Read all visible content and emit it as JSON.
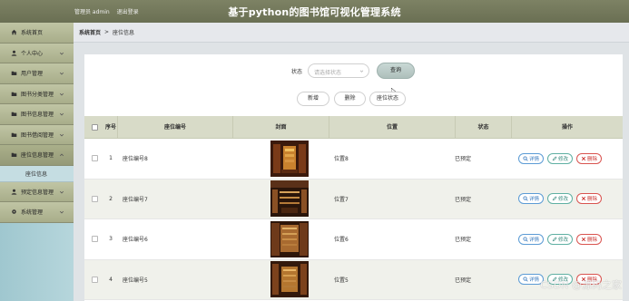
{
  "header": {
    "user_label": "管理员 admin",
    "logout_label": "退出登录",
    "title": "基于python的图书馆可视化管理系统"
  },
  "sidebar": {
    "items": [
      {
        "label": "系统首页",
        "icon": "home-icon",
        "has_chevron": false
      },
      {
        "label": "个人中心",
        "icon": "user-icon",
        "has_chevron": true
      },
      {
        "label": "用户管理",
        "icon": "folder-icon",
        "has_chevron": true
      },
      {
        "label": "图书分类管理",
        "icon": "folder-icon",
        "has_chevron": true
      },
      {
        "label": "图书信息管理",
        "icon": "folder-icon",
        "has_chevron": true
      },
      {
        "label": "图书借阅管理",
        "icon": "folder-icon",
        "has_chevron": true
      },
      {
        "label": "座位信息管理",
        "icon": "folder-icon",
        "has_chevron": true,
        "active": true
      },
      {
        "label": "预定信息管理",
        "icon": "user-icon",
        "has_chevron": true
      },
      {
        "label": "系统管理",
        "icon": "gear-icon",
        "has_chevron": true
      }
    ],
    "submenu_label": "座位信息"
  },
  "breadcrumb": {
    "home": "系统首页",
    "separator": ">",
    "current": "座位信息"
  },
  "filter": {
    "status_label": "状态",
    "status_placeholder": "请选择状态",
    "query_label": "查询"
  },
  "actions": {
    "add_label": "新增",
    "delete_label": "删除",
    "seat_status_label": "座位状态"
  },
  "table": {
    "headers": {
      "no": "序号",
      "name": "座位编号",
      "image": "封面",
      "location": "位置",
      "status": "状态",
      "operation": "操作"
    },
    "rows": [
      {
        "no": "1",
        "name": "座位编号8",
        "location": "位置8",
        "status": "已预定"
      },
      {
        "no": "2",
        "name": "座位编号7",
        "location": "位置7",
        "status": "已预定"
      },
      {
        "no": "3",
        "name": "座位编号6",
        "location": "位置6",
        "status": "已预定"
      },
      {
        "no": "4",
        "name": "座位编号5",
        "location": "位置5",
        "status": "已预定"
      }
    ],
    "op_labels": {
      "view": "详情",
      "edit": "修改",
      "delete": "删除"
    }
  },
  "watermark": "CSDN @源码之家",
  "colors": {
    "header_bg": "#737859",
    "sidebar_bg": "#b0d2d8",
    "menu_bg": "#b5ba97",
    "view_color": "#3a7bbf",
    "edit_color": "#3a8c7f",
    "delete_color": "#c9302c"
  }
}
